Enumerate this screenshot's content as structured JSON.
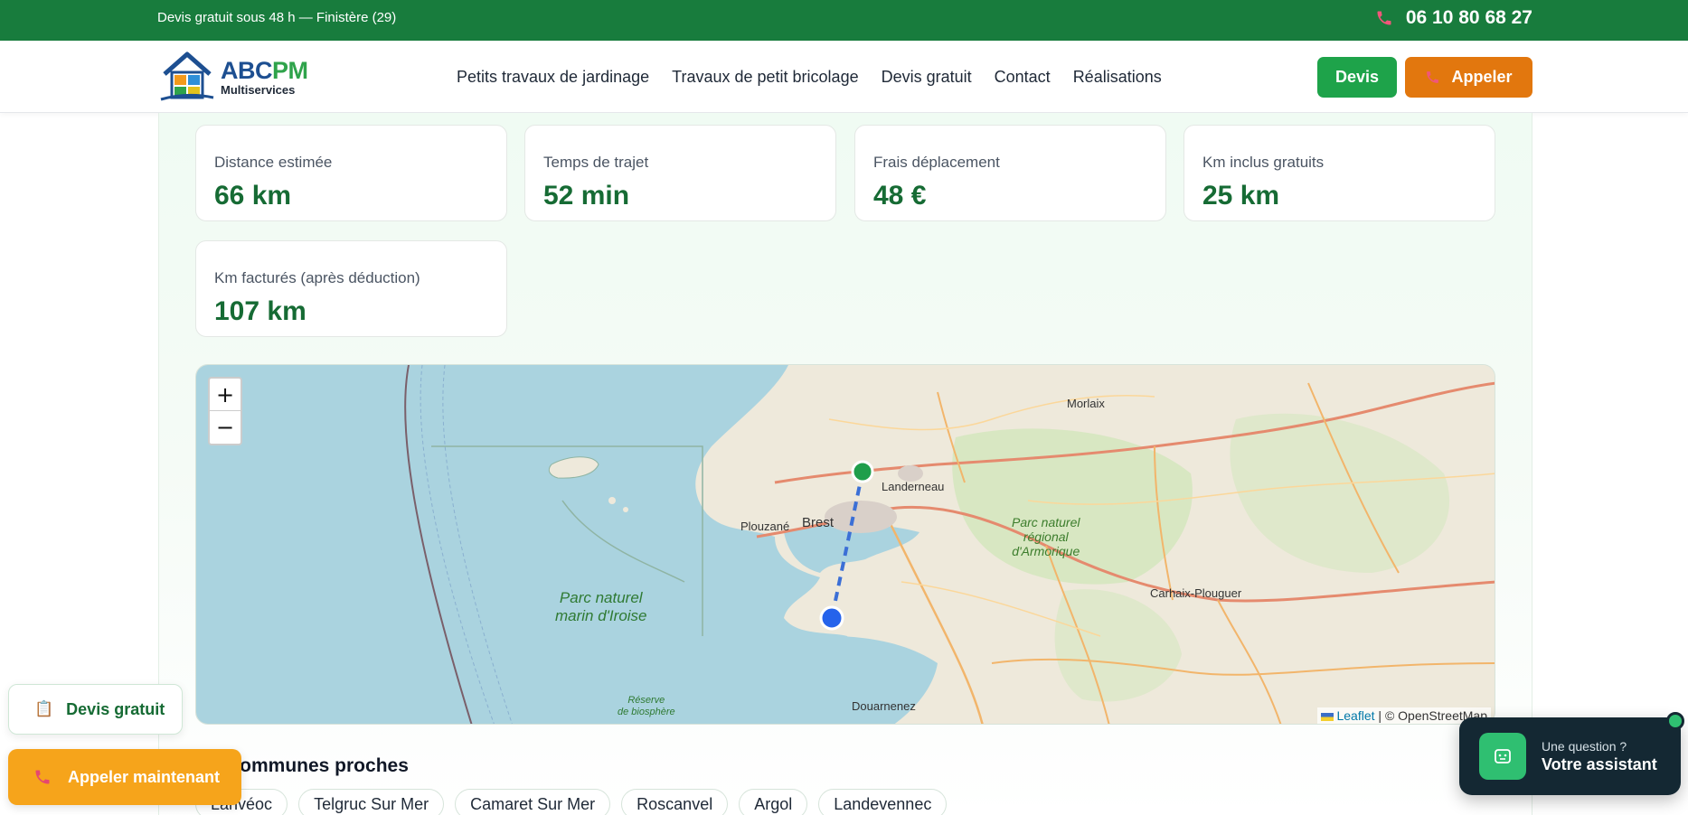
{
  "topbar": {
    "info": "Devis gratuit sous 48 h — Finistère (29)",
    "phone": "06 10 80 68 27"
  },
  "header": {
    "logo_name_a": "ABC",
    "logo_name_b": "PM",
    "logo_sub": "Multiservices",
    "nav": [
      "Petits travaux de jardinage",
      "Travaux de petit bricolage",
      "Devis gratuit",
      "Contact",
      "Réalisations"
    ],
    "devis_label": "Devis",
    "appeler_label": "Appeler"
  },
  "stats": [
    {
      "label": "Distance estimée",
      "value": "66 km"
    },
    {
      "label": "Temps de trajet",
      "value": "52 min"
    },
    {
      "label": "Frais déplacement",
      "value": "48 €"
    },
    {
      "label": "Km inclus gratuits",
      "value": "25 km"
    },
    {
      "label": "Km facturés (après déduction)",
      "value": "107 km"
    }
  ],
  "map": {
    "zoom_in": "+",
    "zoom_out": "−",
    "attribution_link": "Leaflet",
    "attribution_text": "| © OpenStreetMap",
    "labels": {
      "morlaix": "Morlaix",
      "landerneau": "Landerneau",
      "brest": "Brest",
      "plouzane": "Plouzané",
      "armorique_1": "Parc naturel",
      "armorique_2": "régional",
      "armorique_3": "d'Armorique",
      "carhaix": "Carhaix-Plouguer",
      "iroise_1": "Parc naturel",
      "iroise_2": "marin d'Iroise",
      "reserve_1": "Réserve",
      "reserve_2": "de biosphère",
      "douarnenez": "Douarnenez"
    },
    "colors": {
      "origin": "#1f9e4b",
      "destination": "#2563eb",
      "route": "#3b6fd6"
    }
  },
  "communes": {
    "title": "Communes proches",
    "items": [
      "Lanvéoc",
      "Telgruc Sur Mer",
      "Camaret Sur Mer",
      "Roscanvel",
      "Argol",
      "Landevennec"
    ]
  },
  "floating": {
    "devis": "Devis gratuit",
    "call": "Appeler maintenant"
  },
  "assistant": {
    "question": "Une question ?",
    "title": "Votre assistant"
  }
}
